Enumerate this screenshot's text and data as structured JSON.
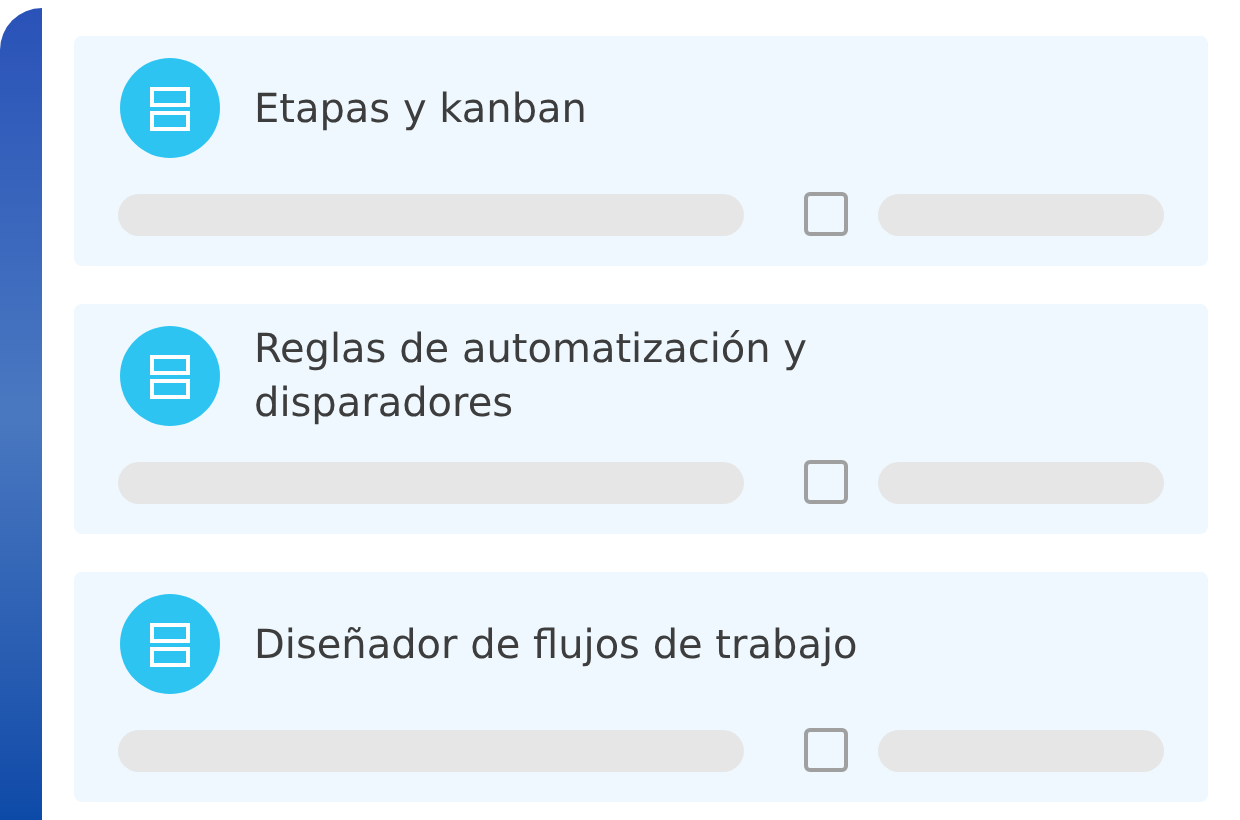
{
  "cards": [
    {
      "title": "Etapas y kanban",
      "checked": false
    },
    {
      "title": "Reglas de automatización y disparadores",
      "checked": false
    },
    {
      "title": "Diseñador de flujos de trabajo",
      "checked": false
    }
  ]
}
